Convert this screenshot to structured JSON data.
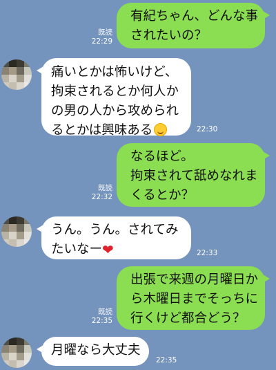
{
  "messages": [
    {
      "side": "out",
      "lines": [
        "有紀ちゃん、どんな事",
        "されたいの？"
      ],
      "read": "既読",
      "time": "22:29"
    },
    {
      "side": "in",
      "lines": [
        "痛いとかは怖いけど、",
        "拘束されるとか何人か",
        "の男の人から攻められ",
        "るとかは興味ある"
      ],
      "emoji": "smiling-face-icon",
      "time": "22:30"
    },
    {
      "side": "out",
      "lines": [
        "なるほど。",
        "拘束されて舐めなれま",
        "くるとか？"
      ],
      "read": "既読",
      "time": "22:32"
    },
    {
      "side": "in",
      "lines": [
        "うん。うん。されてみ",
        "たいなー"
      ],
      "emoji": "heart-icon",
      "time": "22:33"
    },
    {
      "side": "out",
      "lines": [
        "出張で来週の月曜日か",
        "ら木曜日までそっちに",
        "行くけど都合どう？"
      ],
      "read": "既読",
      "time": "22:35"
    },
    {
      "side": "in",
      "lines": [
        "月曜なら大丈夫"
      ],
      "time": "22:35"
    }
  ],
  "colors": {
    "background": "#7594bd",
    "outgoing_bubble": "#8bdd51",
    "incoming_bubble": "#ffffff"
  }
}
